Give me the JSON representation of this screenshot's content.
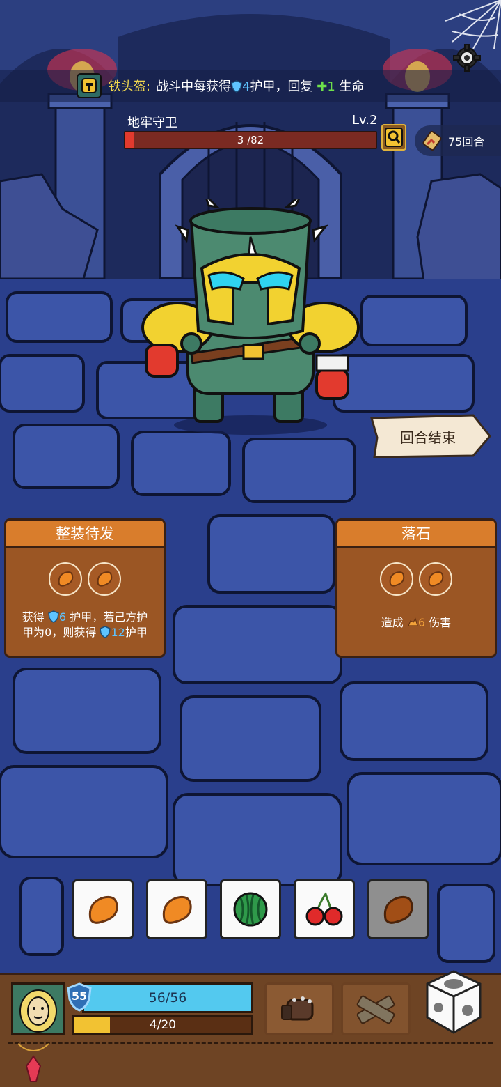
{
  "relic": {
    "name": "铁头盔:",
    "desc_part1": "战斗中每获得",
    "armor_amount": "4",
    "desc_part2": "护甲，回复",
    "heal_amount": "1",
    "desc_part3": "生命"
  },
  "enemy": {
    "name": "地牢守卫",
    "level": "Lv.2",
    "hp_text": "3 /82",
    "hp_fraction": 0.037
  },
  "turns": {
    "label": "75回合"
  },
  "end_turn": {
    "label": "回合结束"
  },
  "cards": {
    "left": {
      "title": "整装待发",
      "text_a": "获得",
      "amount_a": "6",
      "text_b": "护甲，若己方护",
      "text_c": "甲为0，则获得",
      "amount_b": "12",
      "text_d": "护甲"
    },
    "right": {
      "title": "落石",
      "text_a": "造成",
      "amount_a": "6",
      "text_b": "伤害"
    }
  },
  "dice": [
    {
      "icon": "sweet-potato-icon",
      "used": false
    },
    {
      "icon": "sweet-potato-icon",
      "used": false
    },
    {
      "icon": "watermelon-icon",
      "used": false
    },
    {
      "icon": "cherry-icon",
      "used": false
    },
    {
      "icon": "sweet-potato-icon",
      "used": true
    }
  ],
  "player": {
    "shield_level": "55",
    "hp_text": "56/56",
    "xp_text": "4/20",
    "xp_fraction": 0.2
  },
  "colors": {
    "accent_orange": "#d97d2c",
    "hp_red": "#e23a2e",
    "hp_blue": "#53c9ef",
    "xp_yellow": "#f2c232"
  }
}
